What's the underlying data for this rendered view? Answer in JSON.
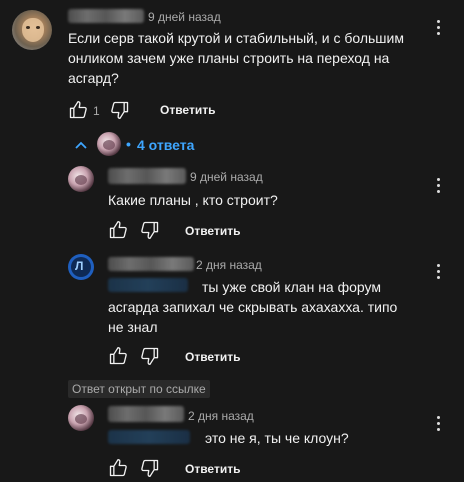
{
  "comment": {
    "time": "9 дней назад",
    "text_lines": [
      "Если серв такой крутой и стабильный, и с большим",
      "онликом зачем уже планы строить на переход на",
      "асгард?"
    ],
    "like_count": "1",
    "reply_label": "Ответить"
  },
  "replies_toggle": {
    "label": "4 ответа",
    "dot": "•"
  },
  "replies": [
    {
      "time": "9 дней назад",
      "text_lines": [
        "Какие планы , кто строит?"
      ],
      "reply_label": "Ответить"
    },
    {
      "time": "2 дня назад",
      "text_lines": [
        "ты уже свой клан на форум",
        "асгарда запихал че скрывать ахахахха. типо",
        "не знал"
      ],
      "reply_label": "Ответить"
    },
    {
      "linked_badge": "Ответ открыт по ссылке",
      "time": "2 дня назад",
      "text_lines": [
        "это не я, ты че клоун?"
      ],
      "reply_label": "Ответить"
    }
  ],
  "colors": {
    "background": "#181818",
    "link": "#3ea6ff",
    "secondary_text": "#aaaaaa"
  },
  "icons": [
    "avatar",
    "like-icon",
    "dislike-icon",
    "more-options-icon",
    "chevron-up-icon"
  ]
}
